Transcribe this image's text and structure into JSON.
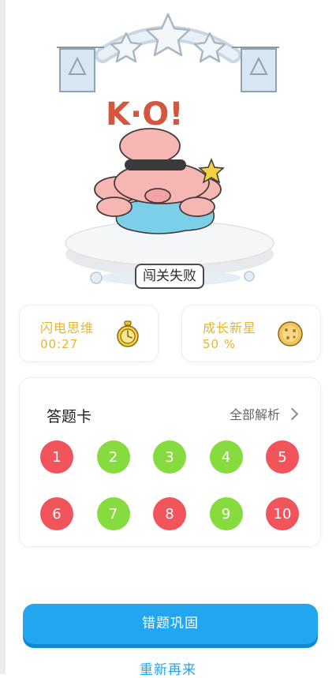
{
  "hero": {
    "ko_text": "K·O!",
    "result_label": "闯关失败"
  },
  "stats": [
    {
      "title": "闪电思维",
      "value": "00:27",
      "icon": "stopwatch-icon"
    },
    {
      "title": "成长新星",
      "value": "50 %",
      "icon": "cookie-icon"
    }
  ],
  "answer_card": {
    "title": "答题卡",
    "view_all": "全部解析",
    "questions": [
      {
        "num": "1",
        "status": "wrong"
      },
      {
        "num": "2",
        "status": "right"
      },
      {
        "num": "3",
        "status": "right"
      },
      {
        "num": "4",
        "status": "right"
      },
      {
        "num": "5",
        "status": "wrong"
      },
      {
        "num": "6",
        "status": "wrong"
      },
      {
        "num": "7",
        "status": "right"
      },
      {
        "num": "8",
        "status": "wrong"
      },
      {
        "num": "9",
        "status": "right"
      },
      {
        "num": "10",
        "status": "wrong"
      }
    ]
  },
  "actions": {
    "primary": "错题巩固",
    "secondary": "重新再来"
  },
  "colors": {
    "wrong": "#f2545b",
    "right": "#86dc3e",
    "accent": "#22a6ef",
    "stat_text": "#e7b52a"
  }
}
